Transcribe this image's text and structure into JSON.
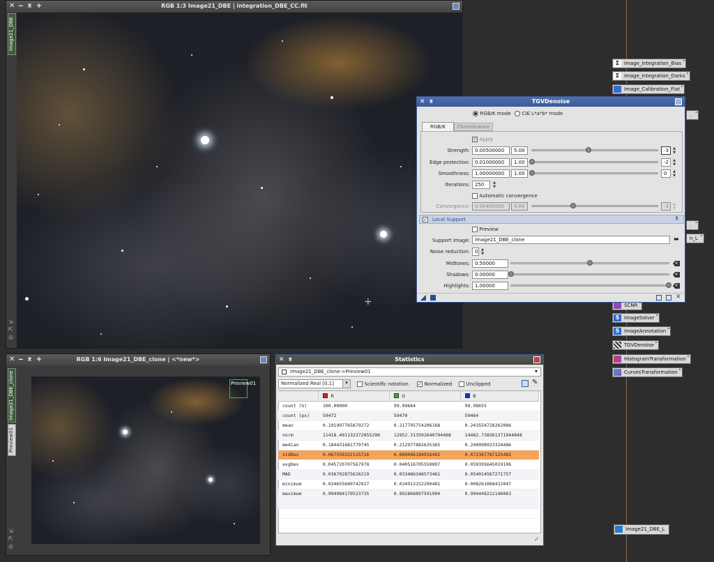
{
  "main_window": {
    "title": "RGB 1:3 Image21_DBE | integration_DBE_CC.fit",
    "side_tab": "Image21_DBE"
  },
  "clone_window": {
    "title": "RGB 1:6 Image21_DBE_clone | <*new*>",
    "side_tabs": [
      "Image21_DBE_clone",
      "Preview01"
    ],
    "preview_label": "Preview01"
  },
  "process_icons": {
    "top": [
      {
        "label": "Image_Integration_Bias",
        "icon": "sigma-icon"
      },
      {
        "label": "Image_Integration_Darks",
        "icon": "sigma-icon"
      },
      {
        "label": "Image_Calibration_Flat",
        "icon": "calibration-icon"
      }
    ],
    "bottom": [
      {
        "label": "SCNR",
        "icon": "scnr-icon"
      },
      {
        "label": "ImageSolver",
        "icon": "script-icon"
      },
      {
        "label": "ImageAnnotation",
        "icon": "script-icon"
      },
      {
        "label": "TGVDenoise",
        "icon": "tgv-icon"
      },
      {
        "label": "HistogramTransformation",
        "icon": "histogram-icon"
      },
      {
        "label": "CurvesTransformation",
        "icon": "curves-icon"
      }
    ],
    "partial": [
      "n_L"
    ],
    "image_icon": "Image21_DBE_L"
  },
  "tgv": {
    "title": "TGVDenoise",
    "mode_rgbk": "RGB/K mode",
    "mode_lab": "CIE L*a*b* mode",
    "tabs": [
      "RGB/K",
      "Chrominance"
    ],
    "apply_label": "Apply",
    "strength": {
      "label": "Strength:",
      "value": "0.00500000",
      "mult": "5.00",
      "exp": "-3",
      "slider_frac": 0.45
    },
    "edge": {
      "label": "Edge protection:",
      "value": "0.01000000",
      "mult": "1.00",
      "exp": "-2",
      "slider_frac": 0.0
    },
    "smooth": {
      "label": "Smoothness:",
      "value": "1.00000000",
      "mult": "1.00",
      "exp": "0",
      "slider_frac": 0.0
    },
    "iterations": {
      "label": "Iterations:",
      "value": "250"
    },
    "auto_conv": "Automatic convergence",
    "convergence": {
      "label": "Convergence:",
      "value": "0.00400000",
      "mult": "4.00",
      "exp": "-3",
      "slider_frac": 0.33
    },
    "local_support": "Local Support",
    "preview_label": "Preview",
    "support_image": {
      "label": "Support image:",
      "value": "Image21_DBE_clone"
    },
    "noise_reduction": {
      "label": "Noise reduction:",
      "value": "0"
    },
    "midtones": {
      "label": "Midtones:",
      "value": "0.50000",
      "slider_frac": 0.5
    },
    "shadows": {
      "label": "Shadows:",
      "value": "0.00000",
      "slider_frac": 0.0
    },
    "highlights": {
      "label": "Highlights:",
      "value": "1.00000",
      "slider_frac": 1.0
    }
  },
  "stats": {
    "title": "Statistics",
    "view": "Image21_DBE_clone->Preview01",
    "range": "Normalized Real [0,1]",
    "scientific": "Scientific notation",
    "normalized": "Normalized",
    "unclipped": "Unclipped",
    "columns": [
      {
        "name": "R",
        "color": "#d42020"
      },
      {
        "name": "G",
        "color": "#20c020"
      },
      {
        "name": "B",
        "color": "#2030c0"
      }
    ],
    "rows": [
      {
        "name": "count (%)",
        "r": "100.00000",
        "g": "99.99664",
        "b": "99.98655"
      },
      {
        "name": "count (px)",
        "r": "59472",
        "g": "59470",
        "b": "59464"
      },
      {
        "name": "mean",
        "r": "0.191997765879272",
        "g": "0.217795754206168",
        "b": "0.243554728262086"
      },
      {
        "name": "norm",
        "r": "11418.491132372055290",
        "g": "12952.313502640794468",
        "b": "14482.738361371944848"
      },
      {
        "name": "median",
        "r": "0.184431681779745",
        "g": "0.212977882635365",
        "b": "0.240998923324486"
      },
      {
        "name": "stdDev",
        "r": "0.067550322115716",
        "g": "0.060046184916492",
        "b": "0.072367787125482"
      },
      {
        "name": "avgDev",
        "r": "0.045720707567978",
        "g": "0.040516705550897",
        "b": "0.059395645019106"
      },
      {
        "name": "MAD",
        "r": "0.036702875626219",
        "g": "0.033486348573461",
        "b": "0.054014567271757"
      },
      {
        "name": "minimum",
        "r": "0.024655640742927",
        "g": "0.024913152290481",
        "b": "0.008261068432047"
      },
      {
        "name": "maximum",
        "r": "0.994984179523735",
        "g": "0.992868897591904",
        "b": "0.994448212146063"
      }
    ],
    "selected_row": "stdDev"
  }
}
